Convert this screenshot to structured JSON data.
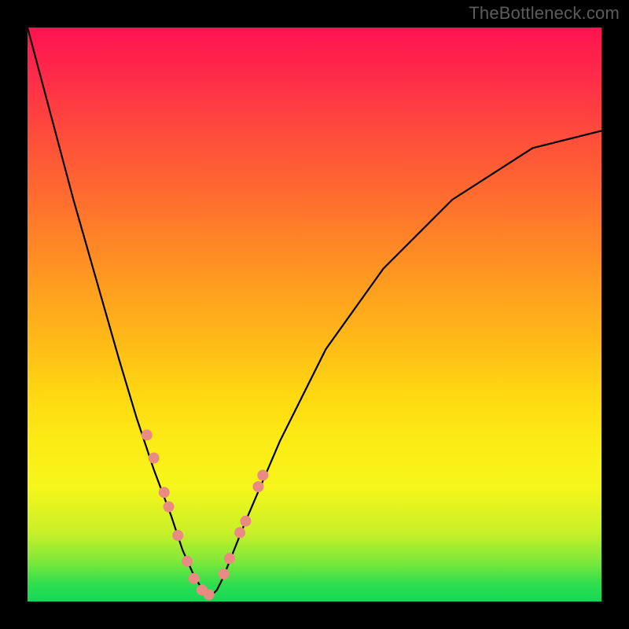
{
  "watermark": {
    "text": "TheBottleneck.com"
  },
  "chart_data": {
    "type": "line",
    "title": "",
    "xlabel": "",
    "ylabel": "",
    "xlim": [
      0,
      100
    ],
    "ylim": [
      0,
      100
    ],
    "grid": false,
    "legend": false,
    "series": [
      {
        "name": "curve",
        "x": [
          0,
          4,
          8,
          12,
          16,
          19,
          22,
          25,
          27,
          29,
          30.5,
          32,
          33,
          34,
          38,
          44,
          52,
          62,
          74,
          88,
          100
        ],
        "y": [
          100,
          85,
          70,
          56,
          42,
          32,
          23,
          15,
          9,
          4.5,
          2,
          1,
          2,
          4,
          14,
          28,
          44,
          58,
          70,
          79,
          82
        ]
      }
    ],
    "scatter": [
      {
        "name": "left-branch-markers",
        "x": [
          20.8,
          22.0,
          23.8,
          24.6,
          26.2,
          27.8,
          29.0,
          30.4,
          31.6
        ],
        "y": [
          29.0,
          25.0,
          19.0,
          16.5,
          11.5,
          7.0,
          4.0,
          2.0,
          1.2
        ]
      },
      {
        "name": "right-branch-markers",
        "x": [
          34.2,
          35.2,
          37.0,
          38.0,
          40.2,
          41.0
        ],
        "y": [
          4.8,
          7.5,
          12.0,
          14.0,
          20.0,
          22.0
        ]
      }
    ],
    "colors": {
      "curve": "#000000",
      "marker_fill": "#e98a83",
      "marker_stroke": "#e98a83",
      "gradient_top": "#ff1350",
      "gradient_bottom": "#14d858"
    }
  }
}
